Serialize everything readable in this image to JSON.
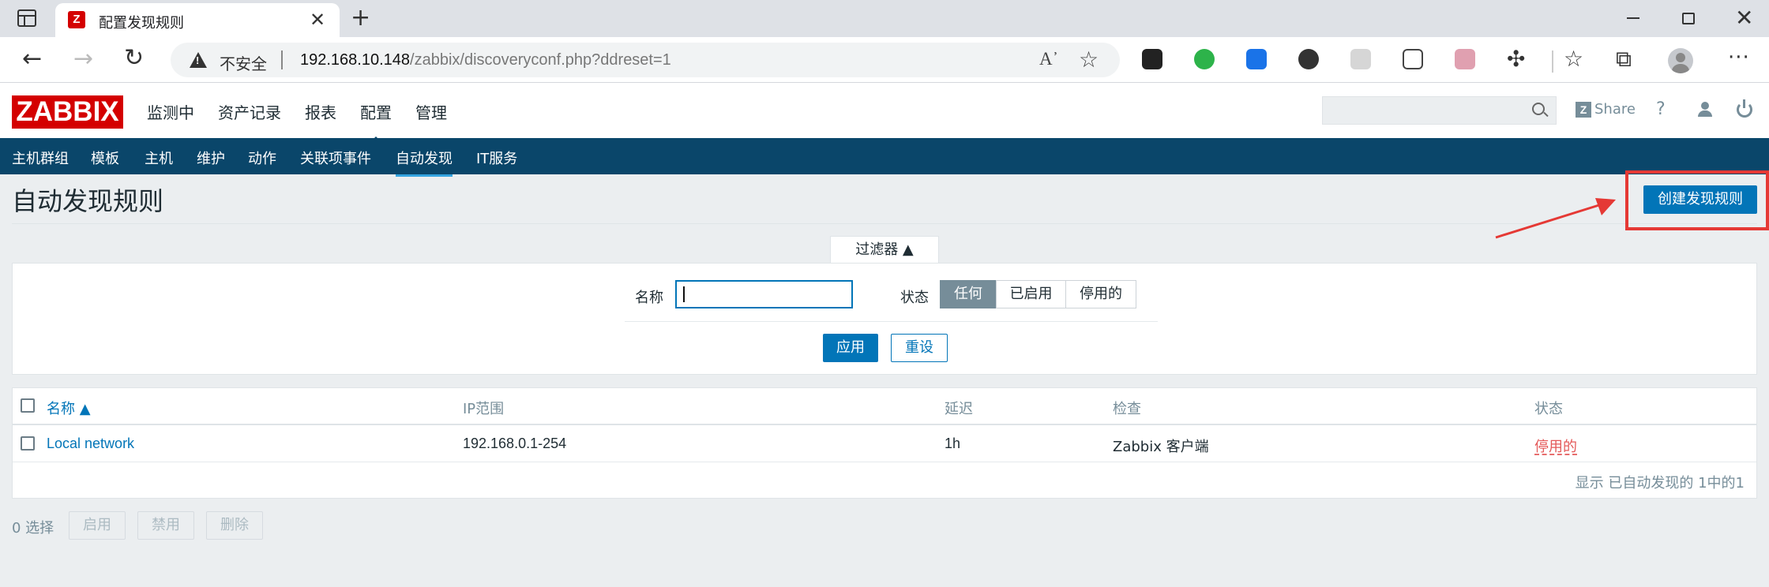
{
  "browser": {
    "tab_title": "配置发现规则",
    "tab_favicon_letter": "Z",
    "insecure_label": "不安全",
    "url_host": "192.168.10.148",
    "url_path": "/zabbix/discoveryconf.php?ddreset=1"
  },
  "header": {
    "logo": "ZABBIX",
    "menu": [
      "监测中",
      "资产记录",
      "报表",
      "配置",
      "管理"
    ],
    "active_menu": "配置",
    "share_label": "Share",
    "help_label": "?"
  },
  "submenu": {
    "items": [
      "主机群组",
      "模板",
      "主机",
      "维护",
      "动作",
      "关联项事件",
      "自动发现",
      "IT服务"
    ],
    "active": "自动发现"
  },
  "page": {
    "title": "自动发现规则",
    "create_button": "创建发现规则"
  },
  "filter": {
    "tab_label": "过滤器 ▲",
    "name_label": "名称",
    "name_value": "",
    "status_label": "状态",
    "status_options": [
      "任何",
      "已启用",
      "停用的"
    ],
    "status_selected": "任何",
    "apply_label": "应用",
    "reset_label": "重设"
  },
  "table": {
    "columns": [
      "名称 ▲",
      "IP范围",
      "延迟",
      "检查",
      "状态"
    ],
    "rows": [
      {
        "name": "Local network",
        "ip_range": "192.168.0.1-254",
        "delay": "1h",
        "checks": "Zabbix 客户端",
        "status": "停用的"
      }
    ],
    "summary": "显示 已自动发现的 1中的1"
  },
  "footer": {
    "selected_count": "0 选择",
    "enable_label": "启用",
    "disable_label": "禁用",
    "delete_label": "删除"
  },
  "colors": {
    "brand_red": "#d40000",
    "primary_blue": "#0275b8",
    "submenu_bg": "#0a466a",
    "disabled_red": "#e45959",
    "annotation_red": "#e53935"
  }
}
